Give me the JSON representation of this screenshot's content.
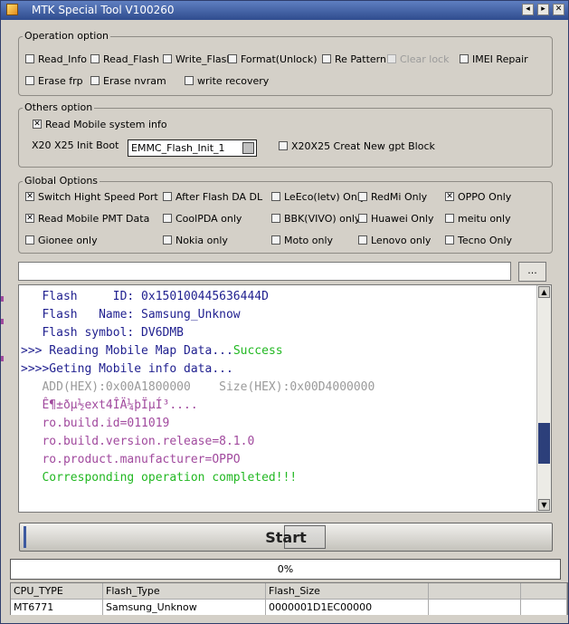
{
  "window": {
    "title": "MTK Special Tool V100260",
    "controls": [
      "◂",
      "▸",
      "✕"
    ]
  },
  "operation_option": {
    "title": "Operation option",
    "items": [
      {
        "label": "Read_Info",
        "checked": false,
        "disabled": false
      },
      {
        "label": "Read_Flash",
        "checked": false,
        "disabled": false
      },
      {
        "label": "Write_Flash",
        "checked": false,
        "disabled": false
      },
      {
        "label": "Format(Unlock)",
        "checked": false,
        "disabled": false
      },
      {
        "label": "Re Pattern l",
        "checked": false,
        "disabled": false
      },
      {
        "label": "Clear lock",
        "checked": false,
        "disabled": true
      },
      {
        "label": "IMEI Repair",
        "checked": false,
        "disabled": false
      },
      {
        "label": "Erase frp",
        "checked": false,
        "disabled": false
      },
      {
        "label": "Erase nvram",
        "checked": false,
        "disabled": false
      },
      {
        "label": "write recovery",
        "checked": false,
        "disabled": false
      }
    ]
  },
  "others_option": {
    "title": "Others option",
    "read_mobile_system_info": {
      "label": "Read Mobile system info",
      "checked": true
    },
    "init_boot_label": "X20 X25 Init Boot",
    "init_boot_value": "EMMC_Flash_Init_1",
    "gpt_block": {
      "label": "X20X25 Creat New gpt Block",
      "checked": false
    }
  },
  "global_options": {
    "title": "Global Options",
    "items": [
      {
        "label": "Switch Hight Speed Port",
        "checked": true
      },
      {
        "label": "After Flash DA DL",
        "checked": false
      },
      {
        "label": "LeEco(letv) Only",
        "checked": false
      },
      {
        "label": "RedMi Only",
        "checked": false
      },
      {
        "label": "OPPO Only",
        "checked": true
      },
      {
        "label": "Read Mobile PMT Data",
        "checked": true
      },
      {
        "label": "CoolPDA only",
        "checked": false
      },
      {
        "label": "BBK(VIVO) only",
        "checked": false
      },
      {
        "label": "Huawei Only",
        "checked": false
      },
      {
        "label": "meitu only",
        "checked": false
      },
      {
        "label": "Gionee only",
        "checked": false
      },
      {
        "label": "Nokia only",
        "checked": false
      },
      {
        "label": "Moto only",
        "checked": false
      },
      {
        "label": "Lenovo only",
        "checked": false
      },
      {
        "label": "Tecno Only",
        "checked": false
      }
    ]
  },
  "file_path": {
    "value": "",
    "browse_label": "..."
  },
  "log": {
    "lines": [
      {
        "text": "   Flash     ID: 0x150100445636444D",
        "color": "#1f1f8f"
      },
      {
        "text": "   Flash   Name: Samsung_Unknow",
        "color": "#1f1f8f"
      },
      {
        "text": "   Flash symbol: DV6DMB",
        "color": "#1f1f8f"
      },
      {
        "text": ">>> Reading Mobile Map Data...",
        "color": "#1f1f8f",
        "suffix": "Success",
        "suffix_color": "#22b822"
      },
      {
        "text": ">>>>Geting Mobile info data...",
        "color": "#1f1f8f"
      },
      {
        "text": "   ADD(HEX):0x00A1800000    Size(HEX):0x00D4000000",
        "color": "#9a9a9a"
      },
      {
        "text": "   Ê¶±ðµ½ext4ÎÄ¼þÏµÍ³....",
        "color": "#a14a9e"
      },
      {
        "text": "   ro.build.id=011019",
        "color": "#a14a9e"
      },
      {
        "text": "   ro.build.version.release=8.1.0",
        "color": "#a14a9e"
      },
      {
        "text": "   ro.product.manufacturer=OPPO",
        "color": "#a14a9e"
      },
      {
        "text": "   Corresponding operation completed!!!",
        "color": "#22b822"
      }
    ]
  },
  "start_button": {
    "label": "Start"
  },
  "progress": {
    "percent": 0,
    "label": "0%"
  },
  "device_table": {
    "headers": [
      "CPU_TYPE",
      "Flash_Type",
      "Flash_Size",
      "",
      ""
    ],
    "row": [
      "MT6771",
      "Samsung_Unknow",
      "0000001D1EC00000",
      "",
      ""
    ]
  },
  "colors": {
    "title_bar": "#2f4c8e",
    "progress_fill": "#3e5aa0",
    "scroll_thumb": "#2c3f7a"
  }
}
